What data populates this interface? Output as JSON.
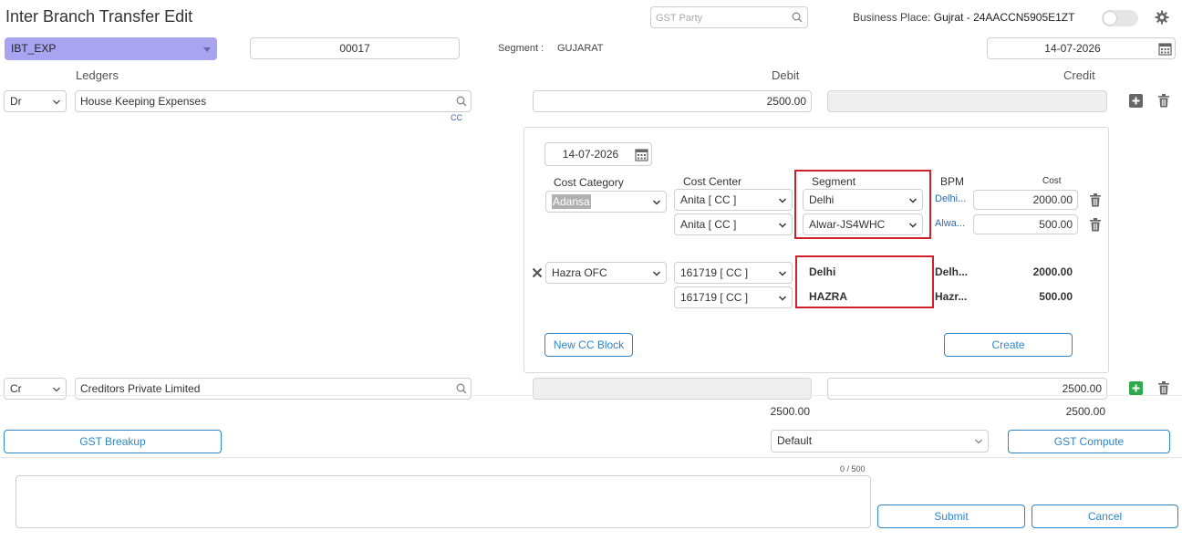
{
  "header": {
    "title": "Inter Branch Transfer Edit",
    "gst_party_placeholder": "GST Party",
    "business_place_label": "Business Place:",
    "business_place_value": "Gujrat - 24AACCN5905E1ZT"
  },
  "top_row": {
    "voucher_type": "IBT_EXP",
    "voucher_number": "00017",
    "segment_label": "Segment :",
    "segment_value": "GUJARAT",
    "date": "14-07-2026"
  },
  "columns": {
    "ledgers": "Ledgers",
    "debit": "Debit",
    "credit": "Credit"
  },
  "entries": [
    {
      "drcr": "Dr",
      "ledger": "House Keeping Expenses",
      "debit": "2500.00",
      "credit": "",
      "cc_link": "CC"
    },
    {
      "drcr": "Cr",
      "ledger": "Creditors Private Limited",
      "debit": "",
      "credit": "2500.00"
    }
  ],
  "cc_panel": {
    "date": "14-07-2026",
    "headers": {
      "cost_category": "Cost Category",
      "cost_center": "Cost Center",
      "segment": "Segment",
      "bpm": "BPM",
      "cost": "Cost"
    },
    "edit_block": {
      "category": "Adansa",
      "rows": [
        {
          "center": "Anita [ CC ]",
          "segment": "Delhi",
          "bpm": "Delhi...",
          "cost": "2000.00"
        },
        {
          "center": "Anita [ CC ]",
          "segment": "Alwar-JS4WHC",
          "bpm": "Alwa...",
          "cost": "500.00"
        }
      ]
    },
    "saved_block": {
      "category": "Hazra OFC",
      "rows": [
        {
          "center": "161719 [ CC ]",
          "segment": "Delhi",
          "bpm": "Delh...",
          "cost": "2000.00"
        },
        {
          "center": "161719 [ CC ]",
          "segment": "HAZRA",
          "bpm": "Hazr...",
          "cost": "500.00"
        }
      ]
    },
    "new_cc_block_label": "New CC Block",
    "create_label": "Create"
  },
  "totals": {
    "debit": "2500.00",
    "credit": "2500.00"
  },
  "footer": {
    "gst_breakup_label": "GST Breakup",
    "default_select": "Default",
    "gst_compute_label": "GST Compute",
    "char_counter": "0 / 500",
    "submit_label": "Submit",
    "cancel_label": "Cancel"
  },
  "colors": {
    "accent": "#2f86c9",
    "voucher_type_bg": "#a8a4f0",
    "highlight_red": "#d0202a",
    "add_green": "#2eaa4a"
  }
}
